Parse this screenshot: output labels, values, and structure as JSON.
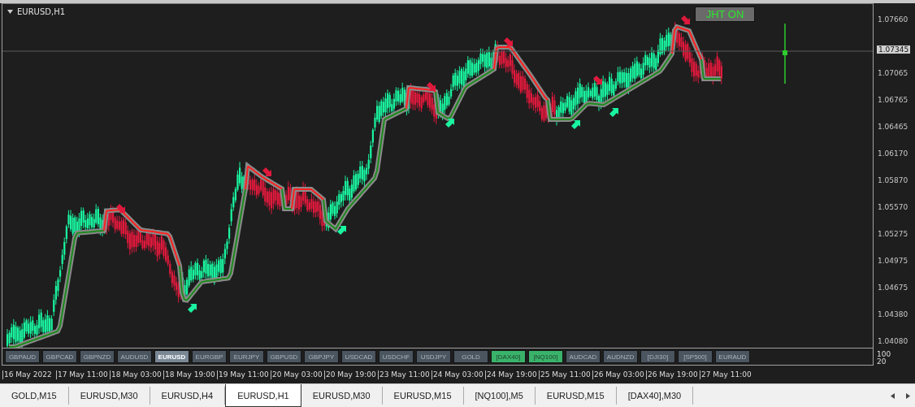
{
  "chart": {
    "title": "EURUSD,H1",
    "status_button": "JHT ON",
    "current_price": "1.07345",
    "price_ticks": [
      "1.07660",
      "1.07065",
      "1.06765",
      "1.06465",
      "1.06170",
      "1.05870",
      "1.05570",
      "1.05275",
      "1.04975",
      "1.04675",
      "1.04380",
      "1.04080"
    ],
    "time_labels": [
      "16 May 2022",
      "17 May 11:00",
      "18 May 03:00",
      "18 May 19:00",
      "19 May 11:00",
      "20 May 03:00",
      "20 May 19:00",
      "23 May 11:00",
      "24 May 03:00",
      "24 May 19:00",
      "25 May 11:00",
      "26 May 03:00",
      "26 May 19:00",
      "27 May 11:00"
    ]
  },
  "symbol_buttons": [
    {
      "label": "GBPAUD",
      "selected": false,
      "highlighted": false
    },
    {
      "label": "GBPCAD",
      "selected": false,
      "highlighted": false
    },
    {
      "label": "GBPNZD",
      "selected": false,
      "highlighted": false
    },
    {
      "label": "AUDUSD",
      "selected": false,
      "highlighted": false
    },
    {
      "label": "EURUSD",
      "selected": true,
      "highlighted": false
    },
    {
      "label": "EURGBP",
      "selected": false,
      "highlighted": false
    },
    {
      "label": "EURJPY",
      "selected": false,
      "highlighted": false
    },
    {
      "label": "GBPUSD",
      "selected": false,
      "highlighted": false
    },
    {
      "label": "GBPJPY",
      "selected": false,
      "highlighted": false
    },
    {
      "label": "USDCAD",
      "selected": false,
      "highlighted": false
    },
    {
      "label": "USDCHF",
      "selected": false,
      "highlighted": false
    },
    {
      "label": "USDJPY",
      "selected": false,
      "highlighted": false
    },
    {
      "label": "GOLD",
      "selected": false,
      "highlighted": false
    },
    {
      "label": "[DAX40]",
      "selected": false,
      "highlighted": true
    },
    {
      "label": "[NQ100]",
      "selected": false,
      "highlighted": true
    },
    {
      "label": "AUDCAD",
      "selected": false,
      "highlighted": false
    },
    {
      "label": "AUDNZD",
      "selected": false,
      "highlighted": false
    },
    {
      "label": "[DJI30]",
      "selected": false,
      "highlighted": false
    },
    {
      "label": "[SP500]",
      "selected": false,
      "highlighted": false
    },
    {
      "label": "EURAUD",
      "selected": false,
      "highlighted": false
    }
  ],
  "indicator_scale": [
    "100",
    "20"
  ],
  "tabs": [
    {
      "label": "GOLD,M15",
      "selected": false
    },
    {
      "label": "EURUSD,M30",
      "selected": false
    },
    {
      "label": "EURUSD,H4",
      "selected": false
    },
    {
      "label": "EURUSD,H1",
      "selected": true
    },
    {
      "label": "EURUSD,M30",
      "selected": false
    },
    {
      "label": "EURUSD,M15",
      "selected": false
    },
    {
      "label": "[NQ100],M5",
      "selected": false
    },
    {
      "label": "EURUSD,M15",
      "selected": false
    },
    {
      "label": "[DAX40],M30",
      "selected": false
    }
  ]
}
